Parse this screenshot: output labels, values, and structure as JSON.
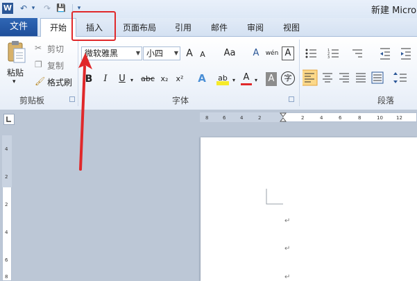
{
  "titlebar": {
    "app_icon": "W",
    "title": "新建 Micro",
    "quick_access": [
      {
        "name": "undo-icon",
        "glyph": "↶"
      },
      {
        "name": "dropdown-icon",
        "glyph": "▾"
      },
      {
        "name": "redo-icon",
        "glyph": "↷"
      },
      {
        "name": "save-icon",
        "glyph": "💾"
      },
      {
        "name": "customize-icon",
        "glyph": "▾"
      }
    ]
  },
  "tabs": {
    "file": "文件",
    "home": "开始",
    "insert": "插入",
    "layout": "页面布局",
    "references": "引用",
    "mailings": "邮件",
    "review": "审阅",
    "view": "视图"
  },
  "clipboard": {
    "paste": "粘贴",
    "cut": "剪切",
    "copy": "复制",
    "format_painter": "格式刷",
    "group_label": "剪贴板"
  },
  "font": {
    "font_name": "微软雅黑",
    "font_size": "小四",
    "grow": "A",
    "shrink": "A",
    "change_case": "Aa",
    "clear": "A",
    "phonetic": "wén",
    "border": "A",
    "bold": "B",
    "italic": "I",
    "underline": "U",
    "strike": "abc",
    "subscript": "x₂",
    "superscript": "x²",
    "text_effect": "A",
    "highlight": "ab",
    "font_color": "A",
    "char_shading": "A",
    "enclose": "字",
    "group_label": "字体"
  },
  "paragraph": {
    "group_label": "段落"
  },
  "ruler": {
    "h_ticks": [
      "8",
      "6",
      "4",
      "2",
      "2",
      "4",
      "6",
      "8",
      "10",
      "12"
    ],
    "v_ticks": [
      "4",
      "2",
      "2",
      "4",
      "6",
      "8"
    ]
  },
  "document": {
    "para_mark": "↵"
  },
  "colors": {
    "accent": "#2b5797",
    "annotation": "#e0282a"
  }
}
